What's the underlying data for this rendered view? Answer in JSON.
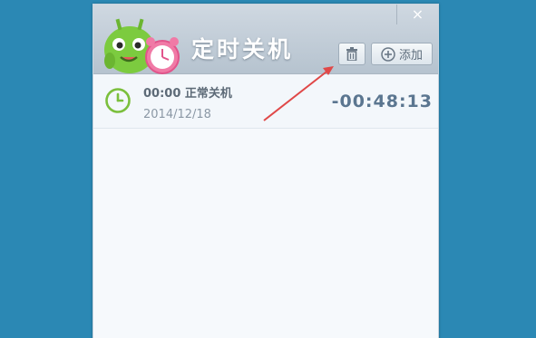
{
  "window": {
    "title": "定时关机",
    "close_glyph": "×"
  },
  "toolbar": {
    "delete_icon": "trash-icon",
    "add_label": "添加",
    "add_icon": "plus-circle-icon"
  },
  "tasks": [
    {
      "time": "00:00",
      "action": "正常关机",
      "date": "2014/12/18",
      "countdown": "-00:48:13",
      "icon": "clock-icon"
    }
  ],
  "colors": {
    "background": "#2b88b4",
    "titlebar": "#c3cdd7",
    "clock_green": "#7bbf3c",
    "countdown": "#5b7690",
    "annotation_arrow": "#e04848"
  }
}
